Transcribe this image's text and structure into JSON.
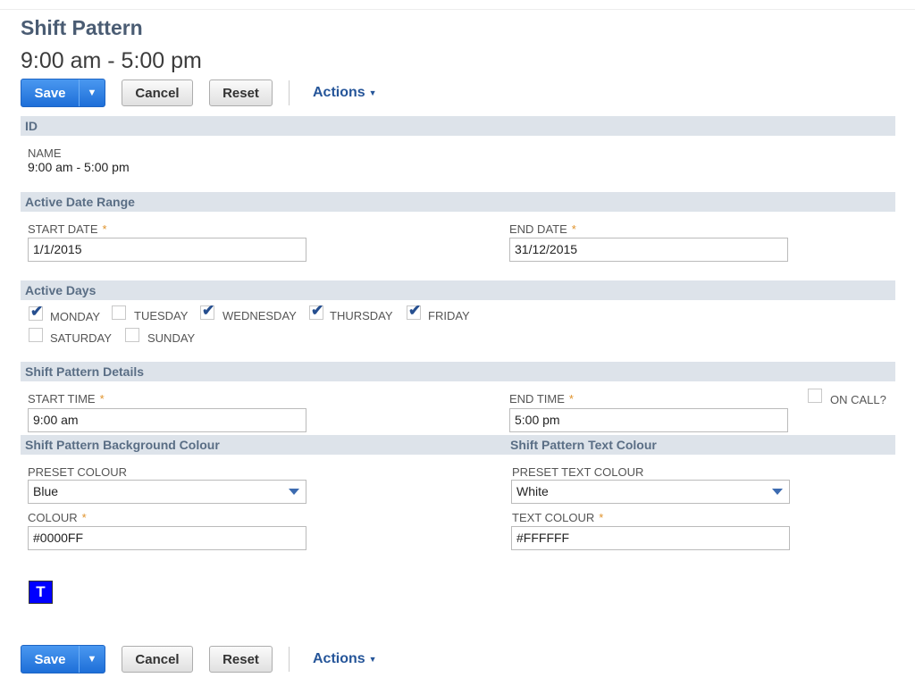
{
  "page": {
    "title": "Shift Pattern",
    "subtitle": "9:00 am - 5:00 pm"
  },
  "toolbar": {
    "save_label": "Save",
    "save_menu_icon": "triangle-down-icon",
    "cancel_label": "Cancel",
    "reset_label": "Reset",
    "actions_label": "Actions",
    "actions_caret": "▾"
  },
  "sections": {
    "id": "ID",
    "active_date_range": "Active Date Range",
    "active_days": "Active Days",
    "details": "Shift Pattern Details",
    "bg_colour": "Shift Pattern Background Colour",
    "text_colour": "Shift Pattern Text Colour"
  },
  "fields": {
    "name_label": "NAME",
    "name_value": "9:00 am - 5:00 pm",
    "start_date_label": "START DATE",
    "start_date_value": "1/1/2015",
    "end_date_label": "END DATE",
    "end_date_value": "31/12/2015",
    "start_time_label": "START TIME",
    "start_time_value": "9:00 am",
    "end_time_label": "END TIME",
    "end_time_value": "5:00 pm",
    "on_call_label": "ON CALL?",
    "on_call_checked": false,
    "preset_colour_label": "PRESET COLOUR",
    "preset_colour_value": "Blue",
    "colour_label": "COLOUR",
    "colour_value": "#0000FF",
    "preset_text_colour_label": "PRESET TEXT COLOUR",
    "preset_text_colour_value": "White",
    "text_colour_label": "TEXT COLOUR",
    "text_colour_value": "#FFFFFF",
    "required_mark": "*"
  },
  "days": [
    {
      "label": "MONDAY",
      "checked": true
    },
    {
      "label": "TUESDAY",
      "checked": false
    },
    {
      "label": "WEDNESDAY",
      "checked": true
    },
    {
      "label": "THURSDAY",
      "checked": true
    },
    {
      "label": "FRIDAY",
      "checked": true
    },
    {
      "label": "SATURDAY",
      "checked": false
    },
    {
      "label": "SUNDAY",
      "checked": false
    }
  ],
  "preview": {
    "letter": "T",
    "background": "#0000FF",
    "text_color": "#FFFFFF"
  },
  "colors": {
    "accent_blue": "#1e6fd8",
    "section_bg": "#dde3ea",
    "required": "#e0932c"
  }
}
